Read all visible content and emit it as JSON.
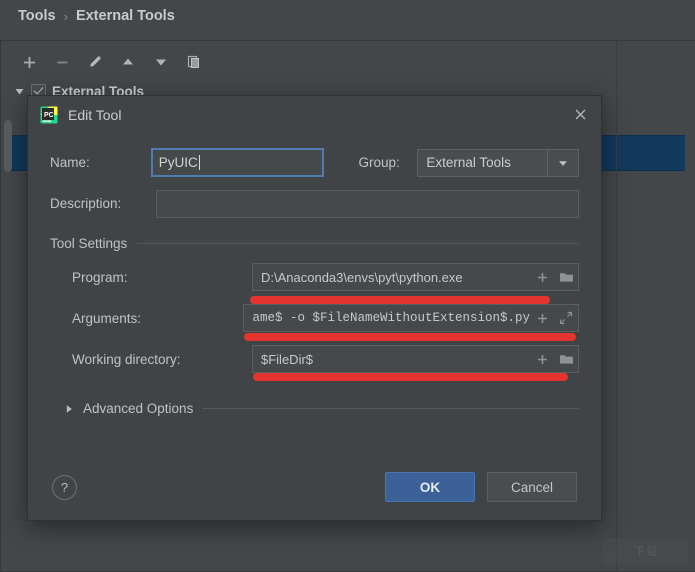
{
  "settings_page": {
    "breadcrumb": {
      "root": "Tools",
      "separator": "›",
      "current": "External Tools"
    },
    "toolbar": {
      "items": [
        {
          "name": "add-icon",
          "label": "Add"
        },
        {
          "name": "remove-icon",
          "label": "Remove"
        },
        {
          "name": "edit-icon",
          "label": "Edit"
        },
        {
          "name": "move-up-icon",
          "label": "Move Up"
        },
        {
          "name": "move-down-icon",
          "label": "Move Down"
        },
        {
          "name": "copy-icon",
          "label": "Copy"
        }
      ]
    },
    "tree": {
      "root_label": "External Tools",
      "root_checked": true,
      "root_expanded": true
    }
  },
  "dialog": {
    "title": "Edit Tool",
    "icon": "pycharm-icon",
    "close_label": "✕",
    "name": {
      "label": "Name:",
      "value": "PyUIC",
      "focused": true
    },
    "group": {
      "label": "Group:",
      "value": "External Tools",
      "options": [
        "External Tools"
      ]
    },
    "description": {
      "label": "Description:",
      "value": "",
      "placeholder": ""
    },
    "tool_settings": {
      "title": "Tool Settings",
      "program": {
        "label": "Program:",
        "value": "D:\\Anaconda3\\envs\\pyt\\python.exe",
        "icons": [
          "insert-macro-icon",
          "browse-folder-icon"
        ]
      },
      "arguments": {
        "label": "Arguments:",
        "value": "ame$ -o $FileNameWithoutExtension$.py",
        "icons": [
          "insert-macro-icon",
          "expand-icon"
        ],
        "annotated": true
      },
      "working_directory": {
        "label": "Working directory:",
        "value": "$FileDir$",
        "icons": [
          "insert-macro-icon",
          "browse-folder-icon"
        ],
        "annotated": true
      }
    },
    "advanced_options": {
      "label": "Advanced Options",
      "expanded": false
    },
    "footer": {
      "help_label": "?",
      "ok_label": "OK",
      "cancel_label": "Cancel"
    }
  },
  "watermark": {
    "text": "下载"
  },
  "colors": {
    "window_background": "#444749",
    "dialog_background": "#414446",
    "field_background": "#45494a",
    "text_primary": "#c0c3c5",
    "focus_border": "#4f7cb3",
    "ok_button": "#3c6199",
    "selection_row": "#113a5c",
    "annotation_red": "#f2332e"
  }
}
